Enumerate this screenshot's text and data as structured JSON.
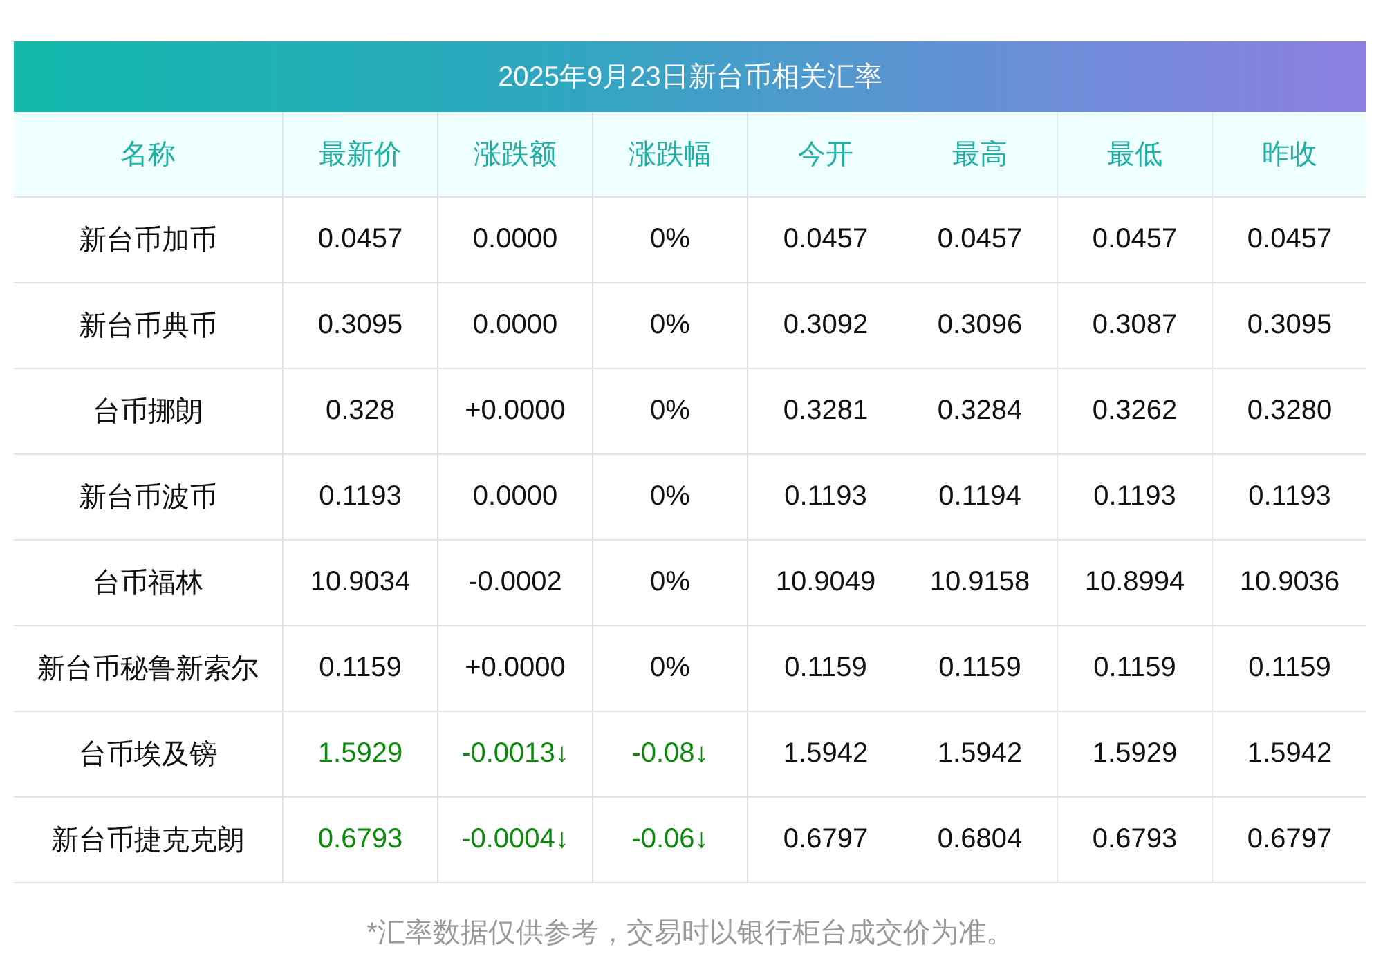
{
  "title": "2025年9月23日新台币相关汇率",
  "columns": [
    "名称",
    "最新价",
    "涨跌额",
    "涨跌幅",
    "今开",
    "最高",
    "最低",
    "昨收"
  ],
  "rows": [
    {
      "kind": "flat",
      "cells": [
        "新台币加币",
        "0.0457",
        "0.0000",
        "0%",
        "0.0457",
        "0.0457",
        "0.0457",
        "0.0457"
      ]
    },
    {
      "kind": "flat",
      "cells": [
        "新台币典币",
        "0.3095",
        "0.0000",
        "0%",
        "0.3092",
        "0.3096",
        "0.3087",
        "0.3095"
      ]
    },
    {
      "kind": "flat",
      "cells": [
        "台币挪朗",
        "0.328",
        "+0.0000",
        "0%",
        "0.3281",
        "0.3284",
        "0.3262",
        "0.3280"
      ]
    },
    {
      "kind": "flat",
      "cells": [
        "新台币波币",
        "0.1193",
        "0.0000",
        "0%",
        "0.1193",
        "0.1194",
        "0.1193",
        "0.1193"
      ]
    },
    {
      "kind": "flat",
      "cells": [
        "台币福林",
        "10.9034",
        "-0.0002",
        "0%",
        "10.9049",
        "10.9158",
        "10.8994",
        "10.9036"
      ]
    },
    {
      "kind": "flat",
      "cells": [
        "新台币秘鲁新索尔",
        "0.1159",
        "+0.0000",
        "0%",
        "0.1159",
        "0.1159",
        "0.1159",
        "0.1159"
      ]
    },
    {
      "kind": "down",
      "cells": [
        "台币埃及镑",
        "1.5929",
        "-0.0013↓",
        "-0.08↓",
        "1.5942",
        "1.5942",
        "1.5929",
        "1.5942"
      ]
    },
    {
      "kind": "down",
      "cells": [
        "新台币捷克克朗",
        "0.6793",
        "-0.0004↓",
        "-0.06↓",
        "0.6797",
        "0.6804",
        "0.6793",
        "0.6797"
      ]
    }
  ],
  "note": "*汇率数据仅供参考，交易时以银行柜台成交价为准。"
}
